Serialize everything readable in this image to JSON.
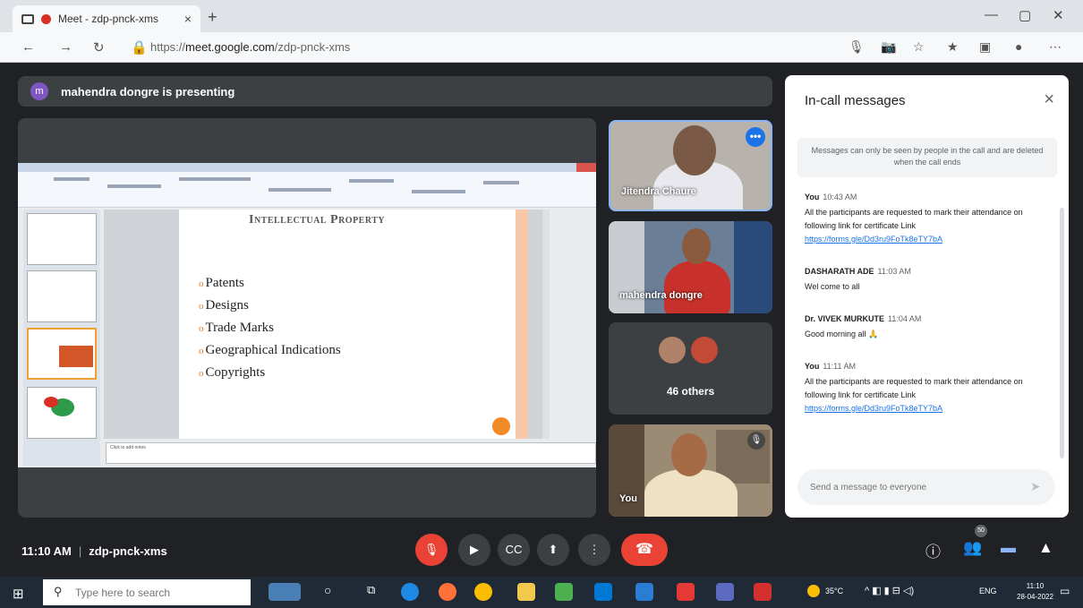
{
  "browser": {
    "tab_title": "Meet - zdp-pnck-xms",
    "tab_close": "×",
    "new_tab": "+",
    "url_prefix": "https://",
    "url_host": "meet.google.com",
    "url_path": "/zdp-pnck-xms"
  },
  "presenting": {
    "avatar_letter": "m",
    "text": "mahendra dongre is presenting"
  },
  "slide": {
    "title": "Intellectual Property",
    "bullets": [
      "Patents",
      "Designs",
      "Trade Marks",
      "Geographical Indications",
      "Copyrights"
    ],
    "notes_placeholder": "Click to add notes"
  },
  "tiles": [
    {
      "name": "Jitendra Chaure",
      "more": "•••"
    },
    {
      "name": "mahendra dongre"
    },
    {
      "name": "46 others"
    },
    {
      "name": "You"
    }
  ],
  "chat": {
    "title": "In-call messages",
    "close": "×",
    "notice": "Messages can only be seen by people in the call and are deleted when the call ends",
    "messages": [
      {
        "who": "You",
        "time": "10:43 AM",
        "text": "All the participants are requested to mark their attendance on following link for certificate   Link",
        "link": "https://forms.gle/Dd3ru9FoTk8eTY7bA"
      },
      {
        "who": "DASHARATH ADE",
        "time": "11:03 AM",
        "text": "Wel come to all",
        "link": ""
      },
      {
        "who": "Dr. VIVEK MURKUTE",
        "time": "11:04 AM",
        "text": "Good morning all 🙏",
        "link": ""
      },
      {
        "who": "You",
        "time": "11:11 AM",
        "text": "All the participants are requested to mark their attendance on following link for certificate   Link",
        "link": "https://forms.gle/Dd3ru9FoTk8eTY7bA"
      }
    ],
    "input_placeholder": "Send a message to everyone"
  },
  "bottom": {
    "time": "11:10 AM",
    "separator": "|",
    "meeting_code": "zdp-pnck-xms",
    "people_count": "50"
  },
  "taskbar": {
    "search_placeholder": "Type here to search",
    "weather": "35°C",
    "lang": "ENG",
    "clock_time": "11:10",
    "clock_date": "28-04-2022"
  },
  "colors": {
    "meet_bg": "#202124",
    "tile_bg": "#3c4043",
    "red": "#ea4335",
    "blue": "#1a73e8"
  }
}
